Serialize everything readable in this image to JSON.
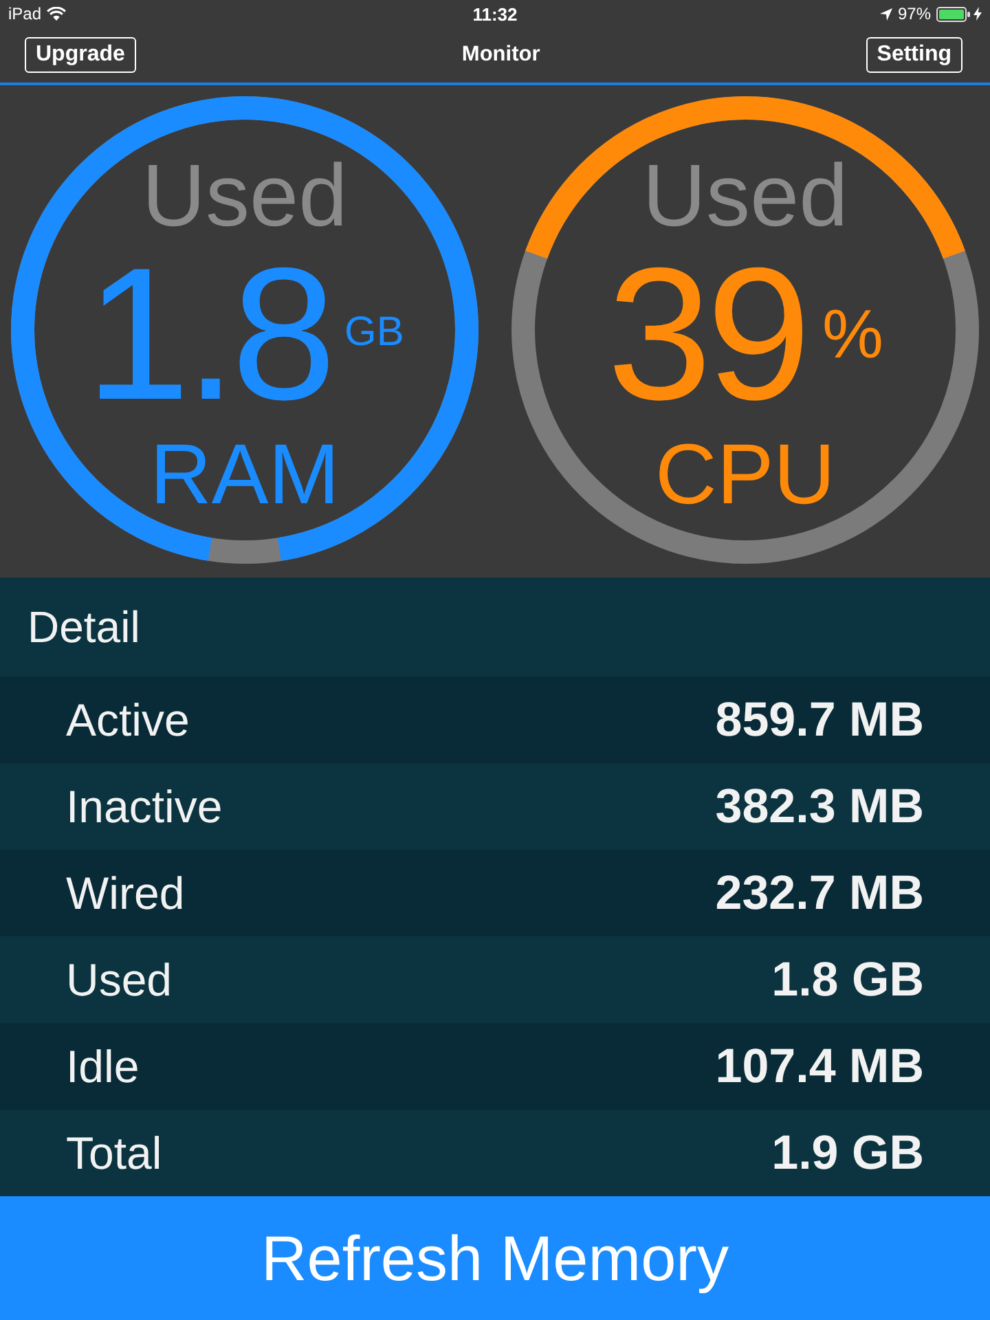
{
  "status_bar": {
    "device": "iPad",
    "time": "11:32",
    "battery": "97%"
  },
  "nav_bar": {
    "left_button": "Upgrade",
    "title": "Monitor",
    "right_button": "Setting"
  },
  "gauges": [
    {
      "kind": "memory",
      "caption": "Used",
      "value": "1.8",
      "unit": "GB",
      "label": "RAM",
      "level": 0.95,
      "color": "#1a8cff"
    },
    {
      "kind": "percent",
      "caption": "Used",
      "value": "39",
      "unit": "%",
      "label": "CPU",
      "level": 0.39,
      "color": "#ff8a0a"
    }
  ],
  "detail": {
    "title": "Detail",
    "rows": [
      {
        "label": "Active",
        "value": "859.7 MB"
      },
      {
        "label": "Inactive",
        "value": "382.3 MB"
      },
      {
        "label": "Wired",
        "value": "232.7 MB"
      },
      {
        "label": "Used",
        "value": "1.8 GB"
      },
      {
        "label": "Idle",
        "value": "107.4 MB"
      },
      {
        "label": "Total",
        "value": "1.9 GB"
      }
    ]
  },
  "refresh_button": "Refresh Memory"
}
